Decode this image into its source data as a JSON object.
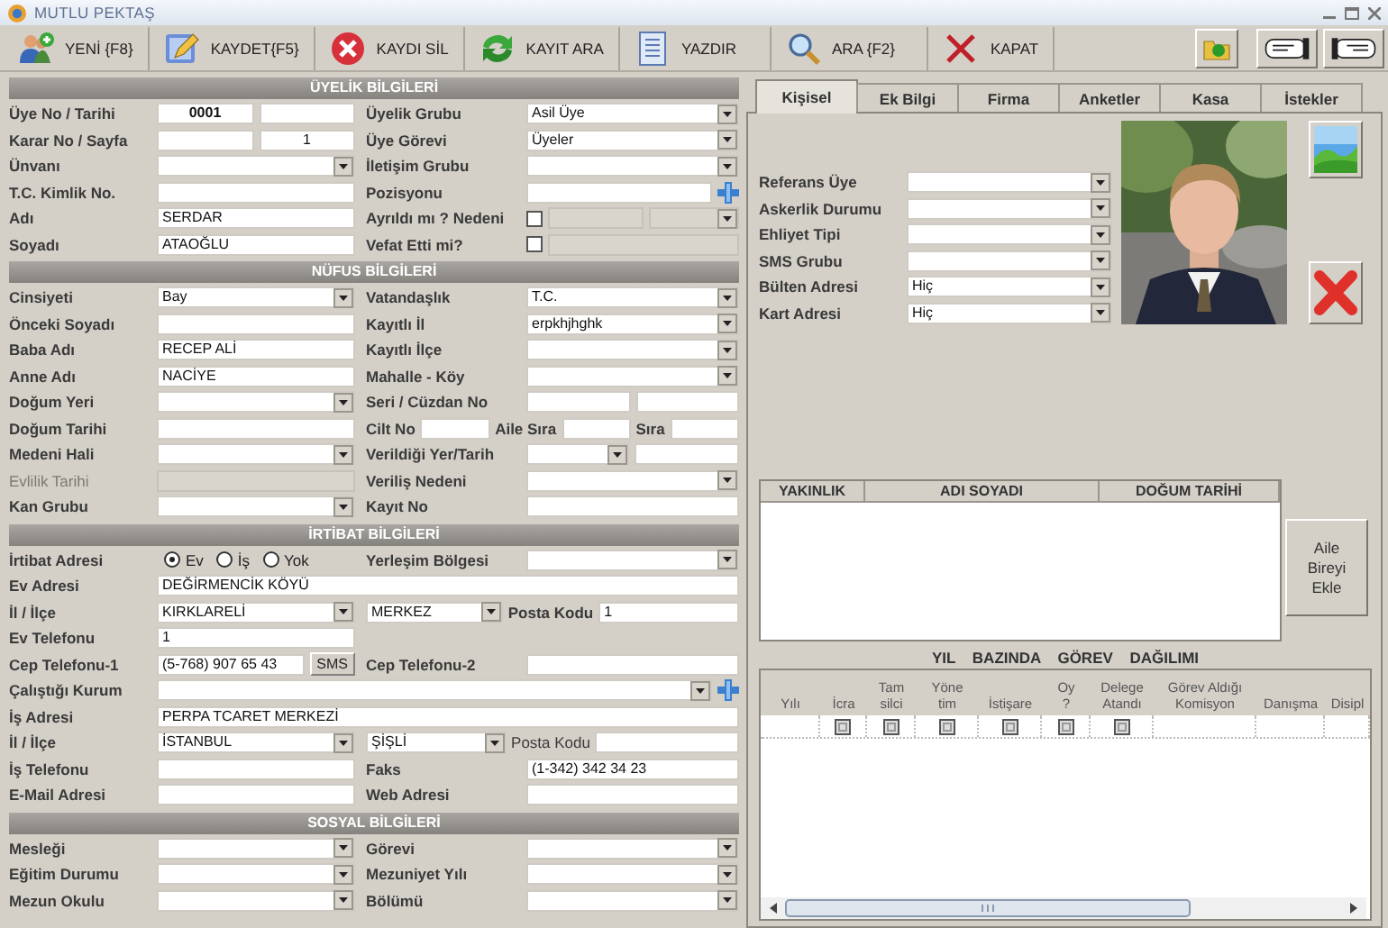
{
  "window": {
    "title": "MUTLU PEKTAŞ"
  },
  "toolbar": [
    {
      "label": "YENİ {F8}"
    },
    {
      "label": "KAYDET{F5}"
    },
    {
      "label": "KAYDI SİL"
    },
    {
      "label": "KAYIT ARA"
    },
    {
      "label": "YAZDIR"
    },
    {
      "label": "ARA {F2}"
    },
    {
      "label": "KAPAT"
    }
  ],
  "form": {
    "sections": [
      {
        "title": "ÜYELİK BİLGİLERİ",
        "rows": [
          {
            "left": [
              {
                "kind": "label",
                "text": "Üye No / Tarihi"
              },
              {
                "kind": "id",
                "value": "0001"
              },
              {
                "kind": "text"
              }
            ],
            "right": [
              {
                "kind": "label",
                "text": "Üyelik Grubu"
              },
              {
                "kind": "combo",
                "value": "Asil Üye"
              }
            ]
          },
          {
            "left": [
              {
                "kind": "label",
                "text": "Karar No / Sayfa"
              },
              {
                "kind": "text"
              },
              {
                "kind": "number",
                "value": "1"
              }
            ],
            "right": [
              {
                "kind": "label",
                "text": "Üye Görevi"
              },
              {
                "kind": "combo",
                "value": "Üyeler"
              }
            ]
          },
          {
            "left": [
              {
                "kind": "label",
                "text": "Ünvanı"
              },
              {
                "kind": "combo"
              }
            ],
            "right": [
              {
                "kind": "label",
                "text": "İletişim Grubu"
              },
              {
                "kind": "combo"
              }
            ]
          },
          {
            "left": [
              {
                "kind": "label",
                "text": "T.C. Kimlik No."
              },
              {
                "kind": "text"
              }
            ],
            "right": [
              {
                "kind": "label",
                "text": "Pozisyonu"
              },
              {
                "kind": "text"
              },
              {
                "kind": "plus"
              }
            ]
          },
          {
            "left": [
              {
                "kind": "label",
                "text": "Adı"
              },
              {
                "kind": "text",
                "value": "SERDAR"
              }
            ],
            "right": [
              {
                "kind": "label",
                "text": "Ayrıldı mı ? Nedeni"
              },
              {
                "kind": "check",
                "checked": false
              },
              {
                "kind": "dim-field"
              },
              {
                "kind": "dim-combo"
              }
            ]
          },
          {
            "left": [
              {
                "kind": "label",
                "text": "Soyadı"
              },
              {
                "kind": "text",
                "value": "ATAOĞLU"
              }
            ],
            "right": [
              {
                "kind": "label",
                "text": "Vefat Etti mi?"
              },
              {
                "kind": "check",
                "checked": false
              },
              {
                "kind": "dim-field"
              }
            ]
          }
        ]
      },
      {
        "title": "NÜFUS BİLGİLERİ",
        "rows": [
          {
            "left": [
              {
                "kind": "label",
                "text": "Cinsiyeti"
              },
              {
                "kind": "combo",
                "value": "Bay"
              }
            ],
            "right": [
              {
                "kind": "label",
                "text": "Vatandaşlık"
              },
              {
                "kind": "combo",
                "value": "T.C."
              }
            ]
          },
          {
            "left": [
              {
                "kind": "label",
                "text": "Önceki Soyadı"
              },
              {
                "kind": "text"
              }
            ],
            "right": [
              {
                "kind": "label",
                "text": "Kayıtlı İl"
              },
              {
                "kind": "combo",
                "value": "erpkhjhghk"
              }
            ]
          },
          {
            "left": [
              {
                "kind": "label",
                "text": "Baba Adı"
              },
              {
                "kind": "text",
                "value": "RECEP ALİ"
              }
            ],
            "right": [
              {
                "kind": "label",
                "text": "Kayıtlı İlçe"
              },
              {
                "kind": "combo"
              }
            ]
          },
          {
            "left": [
              {
                "kind": "label",
                "text": "Anne Adı"
              },
              {
                "kind": "text",
                "value": "NACİYE"
              }
            ],
            "right": [
              {
                "kind": "label",
                "text": "Mahalle - Köy"
              },
              {
                "kind": "combo"
              }
            ]
          },
          {
            "left": [
              {
                "kind": "label",
                "text": "Doğum Yeri"
              },
              {
                "kind": "combo"
              }
            ],
            "right": [
              {
                "kind": "label",
                "text": "Seri / Cüzdan No"
              },
              {
                "kind": "text"
              },
              {
                "kind": "text"
              }
            ]
          },
          {
            "left": [
              {
                "kind": "label",
                "text": "Doğum Tarihi"
              },
              {
                "kind": "text"
              }
            ],
            "right": [
              {
                "kind": "small-label",
                "text": "Cilt No"
              },
              {
                "kind": "text"
              },
              {
                "kind": "small-label",
                "text": "Aile Sıra"
              },
              {
                "kind": "text"
              },
              {
                "kind": "small-label",
                "text": "Sıra"
              },
              {
                "kind": "text"
              }
            ]
          },
          {
            "left": [
              {
                "kind": "label",
                "text": "Medeni Hali"
              },
              {
                "kind": "combo"
              }
            ],
            "right": [
              {
                "kind": "label",
                "text": "Verildiği Yer/Tarih"
              },
              {
                "kind": "combo"
              },
              {
                "kind": "text"
              }
            ]
          },
          {
            "left": [
              {
                "kind": "dim-label",
                "text": "Evlilik Tarihi"
              },
              {
                "kind": "dim-field"
              }
            ],
            "right": [
              {
                "kind": "label",
                "text": "Veriliş Nedeni"
              },
              {
                "kind": "combo"
              }
            ]
          },
          {
            "left": [
              {
                "kind": "label",
                "text": "Kan Grubu"
              },
              {
                "kind": "combo"
              }
            ],
            "right": [
              {
                "kind": "label",
                "text": "Kayıt No"
              },
              {
                "kind": "text"
              }
            ]
          }
        ]
      },
      {
        "title": "İRTİBAT BİLGİLERİ",
        "rows": [
          {
            "left": [
              {
                "kind": "label",
                "text": "İrtibat Adresi"
              },
              {
                "kind": "radio",
                "text": "Ev",
                "selected": true
              },
              {
                "kind": "radio",
                "text": "İş",
                "selected": false
              },
              {
                "kind": "radio",
                "text": "Yok",
                "selected": false
              }
            ],
            "right": [
              {
                "kind": "label",
                "text": "Yerleşim Bölgesi"
              },
              {
                "kind": "combo"
              }
            ]
          },
          {
            "full": [
              {
                "kind": "label",
                "text": "Ev Adresi"
              },
              {
                "kind": "text",
                "value": "DEĞİRMENCİK KÖYÜ"
              }
            ]
          },
          {
            "left": [
              {
                "kind": "label",
                "text": "İl / İlçe"
              },
              {
                "kind": "combo",
                "value": "KIRKLARELİ"
              }
            ],
            "right": [
              {
                "kind": "combo",
                "value": "MERKEZ"
              },
              {
                "kind": "small-label",
                "text": "Posta Kodu"
              },
              {
                "kind": "text",
                "value": "1"
              }
            ]
          },
          {
            "left": [
              {
                "kind": "label",
                "text": "Ev Telefonu"
              },
              {
                "kind": "text",
                "value": "1"
              }
            ]
          },
          {
            "left": [
              {
                "kind": "label",
                "text": "Cep Telefonu-1"
              },
              {
                "kind": "text",
                "value": "(5-768) 907 65 43"
              },
              {
                "kind": "button",
                "text": "SMS"
              }
            ],
            "right": [
              {
                "kind": "label",
                "text": "Cep Telefonu-2"
              },
              {
                "kind": "text"
              }
            ]
          },
          {
            "full": [
              {
                "kind": "label",
                "text": "Çalıştığı Kurum"
              },
              {
                "kind": "combo"
              },
              {
                "kind": "plus"
              }
            ]
          },
          {
            "full": [
              {
                "kind": "label",
                "text": "İş Adresi"
              },
              {
                "kind": "text",
                "value": "PERPA TCARET MERKEZİ"
              }
            ]
          },
          {
            "left": [
              {
                "kind": "label",
                "text": "İl / İlçe"
              },
              {
                "kind": "combo",
                "value": "İSTANBUL"
              }
            ],
            "right": [
              {
                "kind": "combo",
                "value": "ŞİŞLİ"
              },
              {
                "kind": "plain-label",
                "text": "Posta Kodu"
              },
              {
                "kind": "text"
              }
            ]
          },
          {
            "left": [
              {
                "kind": "label",
                "text": "İş Telefonu"
              },
              {
                "kind": "text"
              }
            ],
            "right": [
              {
                "kind": "label",
                "text": "Faks"
              },
              {
                "kind": "text",
                "value": "(1-342) 342 34 23"
              }
            ]
          },
          {
            "left": [
              {
                "kind": "label",
                "text": "E-Mail Adresi"
              },
              {
                "kind": "text"
              }
            ],
            "right": [
              {
                "kind": "label",
                "text": "Web Adresi"
              },
              {
                "kind": "text"
              }
            ]
          }
        ]
      },
      {
        "title": "SOSYAL BİLGİLERİ",
        "rows": [
          {
            "left": [
              {
                "kind": "label",
                "text": "Mesleği"
              },
              {
                "kind": "combo"
              }
            ],
            "right": [
              {
                "kind": "label",
                "text": "Görevi"
              },
              {
                "kind": "combo"
              }
            ]
          },
          {
            "left": [
              {
                "kind": "label",
                "text": "Eğitim Durumu"
              },
              {
                "kind": "combo"
              }
            ],
            "right": [
              {
                "kind": "label",
                "text": "Mezuniyet Yılı"
              },
              {
                "kind": "combo"
              }
            ]
          },
          {
            "left": [
              {
                "kind": "label",
                "text": "Mezun Okulu"
              },
              {
                "kind": "combo"
              }
            ],
            "right": [
              {
                "kind": "label",
                "text": "Bölümü"
              },
              {
                "kind": "combo"
              }
            ]
          }
        ]
      }
    ]
  },
  "tabs": [
    {
      "label": "Kişisel",
      "selected": true
    },
    {
      "label": "Ek Bilgi",
      "selected": false
    },
    {
      "label": "Firma",
      "selected": false
    },
    {
      "label": "Anketler",
      "selected": false
    },
    {
      "label": "Kasa",
      "selected": false
    },
    {
      "label": "İstekler",
      "selected": false
    }
  ],
  "personal": {
    "rows": [
      {
        "label": "Referans Üye"
      },
      {
        "label": "Askerlik Durumu"
      },
      {
        "label": "Ehliyet Tipi"
      },
      {
        "label": "SMS Grubu"
      },
      {
        "label": "Bülten Adresi",
        "value": "Hiç"
      },
      {
        "label": "Kart Adresi",
        "value": "Hiç"
      }
    ]
  },
  "family": {
    "columns": [
      "YAKINLIK",
      "ADI SOYADI",
      "DOĞUM TARİHİ"
    ],
    "add_button": "Aile Bireyi Ekle"
  },
  "duties": {
    "title": "YIL BAZINDA GÖREV DAĞILIMI",
    "columns": [
      "Yılı",
      "İcra",
      "Tam\nsilci",
      "Yöne\ntim",
      "İstişare",
      "Oy\n?",
      "Delege\nAtandı",
      "Görev Aldığı\nKomisyon",
      "Danışma",
      "Disipl"
    ],
    "rows": [
      {
        "cells": [
          {
            "kind": "empty"
          },
          {
            "kind": "check",
            "checked": false
          },
          {
            "kind": "check",
            "checked": false
          },
          {
            "kind": "check",
            "checked": false
          },
          {
            "kind": "check",
            "checked": false
          },
          {
            "kind": "check",
            "checked": false
          },
          {
            "kind": "check",
            "checked": false
          },
          {
            "kind": "empty"
          },
          {
            "kind": "empty"
          },
          {
            "kind": "empty"
          }
        ]
      }
    ]
  }
}
